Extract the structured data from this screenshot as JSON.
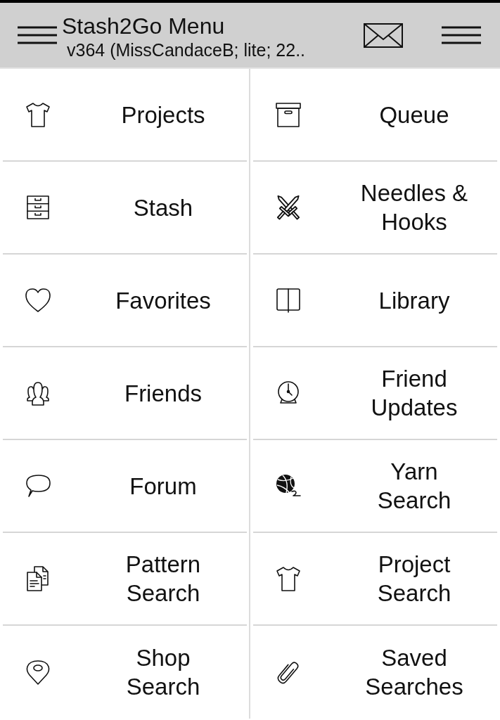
{
  "header": {
    "title": "Stash2Go Menu",
    "subtitle": "v364 (MissCandaceB; lite; 22.."
  },
  "menu": {
    "rows": [
      {
        "cells": [
          {
            "label": "Projects"
          },
          {
            "label": "Queue"
          }
        ]
      },
      {
        "cells": [
          {
            "label": "Stash"
          },
          {
            "label": "Needles & Hooks"
          }
        ]
      },
      {
        "cells": [
          {
            "label": "Favorites"
          },
          {
            "label": "Library"
          }
        ]
      },
      {
        "cells": [
          {
            "label": "Friends"
          },
          {
            "label": "Friend Updates"
          }
        ]
      },
      {
        "cells": [
          {
            "label": "Forum"
          },
          {
            "label": "Yarn Search"
          }
        ]
      },
      {
        "cells": [
          {
            "label": "Pattern Search"
          },
          {
            "label": "Project Search"
          }
        ]
      },
      {
        "cells": [
          {
            "label": "Shop Search"
          },
          {
            "label": "Saved Searches"
          }
        ]
      }
    ]
  }
}
